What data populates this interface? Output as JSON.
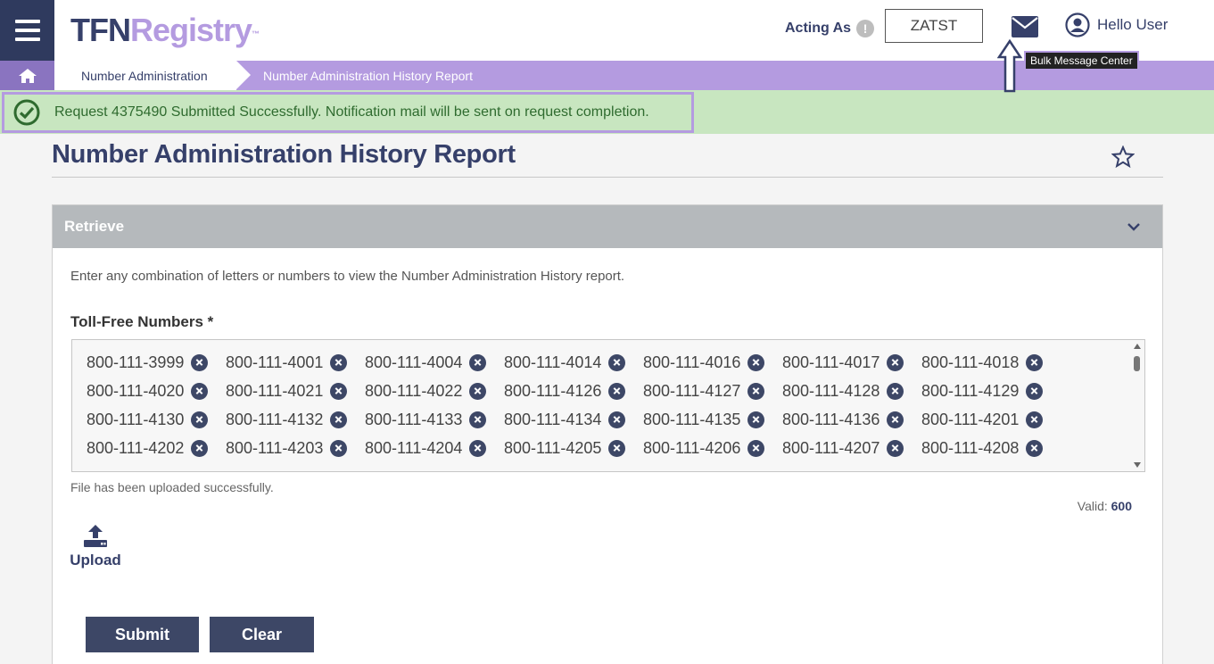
{
  "header": {
    "logo_tfn": "TFN",
    "logo_registry": "Registry",
    "logo_tm": "™",
    "acting_as_label": "Acting As",
    "acting_as_info_glyph": "!",
    "acting_as_value": "ZATST",
    "user_greeting": "Hello User",
    "mail_tooltip": "Bulk Message Center"
  },
  "breadcrumb": {
    "items": [
      "Number Administration",
      "Number Administration History Report"
    ]
  },
  "notification": {
    "text": "Request 4375490 Submitted Successfully. Notification mail will be sent on request completion."
  },
  "page": {
    "title": "Number Administration History Report"
  },
  "panel": {
    "title": "Retrieve",
    "instruction": "Enter any combination of letters or numbers to view the Number Administration History report.",
    "tfn_label": "Toll-Free Numbers *",
    "tfn_rows": [
      [
        "800-111-3999",
        "800-111-4001",
        "800-111-4004",
        "800-111-4014",
        "800-111-4016",
        "800-111-4017",
        "800-111-4018"
      ],
      [
        "800-111-4020",
        "800-111-4021",
        "800-111-4022",
        "800-111-4126",
        "800-111-4127",
        "800-111-4128",
        "800-111-4129"
      ],
      [
        "800-111-4130",
        "800-111-4132",
        "800-111-4133",
        "800-111-4134",
        "800-111-4135",
        "800-111-4136",
        "800-111-4201"
      ],
      [
        "800-111-4202",
        "800-111-4203",
        "800-111-4204",
        "800-111-4205",
        "800-111-4206",
        "800-111-4207",
        "800-111-4208"
      ]
    ],
    "upload_status": "File has been uploaded successfully.",
    "valid_label": "Valid:",
    "valid_count": "600",
    "upload_label": "Upload",
    "submit_label": "Submit",
    "clear_label": "Clear"
  },
  "colors": {
    "navy": "#36406a",
    "lavender": "#b49be0",
    "success_bg": "#c8e6c0",
    "button": "#3d4766"
  },
  "icons": [
    "menu-icon",
    "home-icon",
    "info-icon",
    "mail-icon",
    "user-icon",
    "check-circle-icon",
    "star-icon",
    "chevron-down-icon",
    "remove-icon",
    "upload-icon"
  ]
}
